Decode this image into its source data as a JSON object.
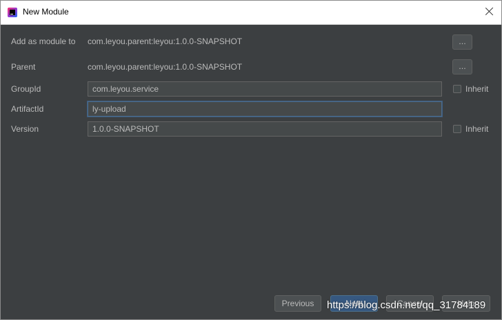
{
  "window": {
    "title": "New Module"
  },
  "form": {
    "add_as_module_to": {
      "label": "Add as module to",
      "value": "com.leyou.parent:leyou:1.0.0-SNAPSHOT",
      "browse": "..."
    },
    "parent": {
      "label": "Parent",
      "value": "com.leyou.parent:leyou:1.0.0-SNAPSHOT",
      "browse": "..."
    },
    "group_id": {
      "label": "GroupId",
      "value": "com.leyou.service",
      "inherit_label": "Inherit"
    },
    "artifact_id": {
      "label": "ArtifactId",
      "value": "ly-upload"
    },
    "version": {
      "label": "Version",
      "value": "1.0.0-SNAPSHOT",
      "inherit_label": "Inherit"
    }
  },
  "buttons": {
    "previous": "Previous",
    "next": "Next",
    "cancel": "Cancel",
    "help": "Help"
  },
  "watermark": "https://blog.csdn.net/qq_31784189",
  "colors": {
    "background": "#3c3f41",
    "primary_button": "#365880",
    "focus_border": "#4d6b8a"
  }
}
